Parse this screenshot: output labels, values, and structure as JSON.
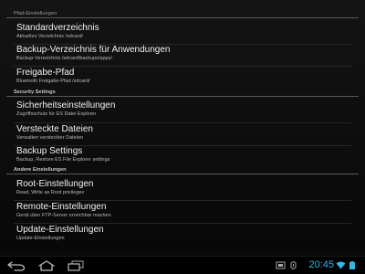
{
  "sections": [
    {
      "header": "Pfad-Einstellungen",
      "items": [
        {
          "title": "Standardverzeichnis",
          "summary": "Aktuelles Verzeichnis /sdcard/"
        },
        {
          "title": "Backup-Verzeichnis für Anwendungen",
          "summary": "Backup-Verzeichnis /sdcard/backups/apps/"
        },
        {
          "title": "Freigabe-Pfad",
          "summary": "Bluetooth Freigabe-Pfad /sdcard/"
        }
      ]
    },
    {
      "header": "Security Settings",
      "items": [
        {
          "title": "Sicherheitseinstellungen",
          "summary": "Zugriffsschutz für ES Datei Explorer"
        },
        {
          "title": "Versteckte Dateien",
          "summary": "Verwalten versteckter Dateien"
        },
        {
          "title": "Backup Settings",
          "summary": "Backup, Restore ES File Explorer settings"
        }
      ]
    },
    {
      "header": "Andere Einstellungen",
      "items": [
        {
          "title": "Root-Einstellungen",
          "summary": "Read, Write as Root privileges"
        },
        {
          "title": "Remote-Einstellungen",
          "summary": "Gerät über FTP-Server erreichbar machen"
        },
        {
          "title": "Update-Einstellungen",
          "summary": "Update-Einstellungen"
        }
      ]
    }
  ],
  "system_bar": {
    "clock": "20:45",
    "accent_color": "#33b5e5",
    "nav_icons": [
      "back-icon",
      "home-icon",
      "recent-apps-icon"
    ],
    "status_icons": [
      "screenshot-icon",
      "usb-debug-icon",
      "wifi-icon",
      "battery-icon"
    ]
  }
}
